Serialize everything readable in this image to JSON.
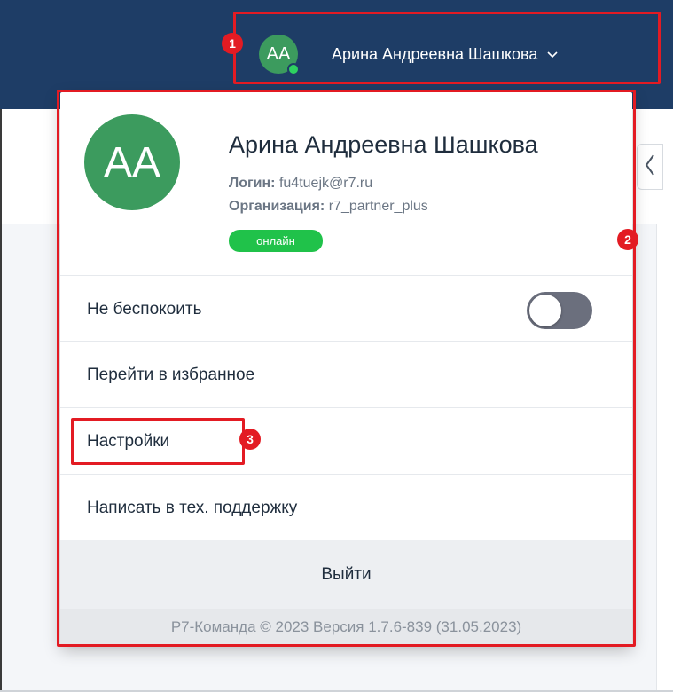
{
  "header": {
    "user": {
      "initials": "AA",
      "name": "Арина Андреевна Шашкова",
      "presence_color": "#2ed160"
    }
  },
  "profile": {
    "initials": "AA",
    "name": "Арина Андреевна Шашкова",
    "login_label": "Логин:",
    "login_value": "fu4tuejk@r7.ru",
    "org_label": "Организация:",
    "org_value": "r7_partner_plus",
    "status": "онлайн",
    "status_color": "#20c24a",
    "avatar_color": "#3c9b5e"
  },
  "menu": {
    "dnd_label": "Не беспокоить",
    "dnd_enabled": false,
    "favorites_label": "Перейти в избранное",
    "settings_label": "Настройки",
    "support_label": "Написать в тех. поддержку",
    "logout_label": "Выйти"
  },
  "footer": {
    "text": "Р7-Команда © 2023 Версия 1.7.6-839 (31.05.2023)"
  },
  "annotations": {
    "markers": [
      "1",
      "2",
      "3"
    ],
    "color": "#e31b23"
  },
  "icons": {
    "collapse": "chevron-left-icon",
    "dropdown": "chevron-down-icon"
  },
  "colors": {
    "topbar": "#1e3d66",
    "accent_red": "#e31b23"
  }
}
